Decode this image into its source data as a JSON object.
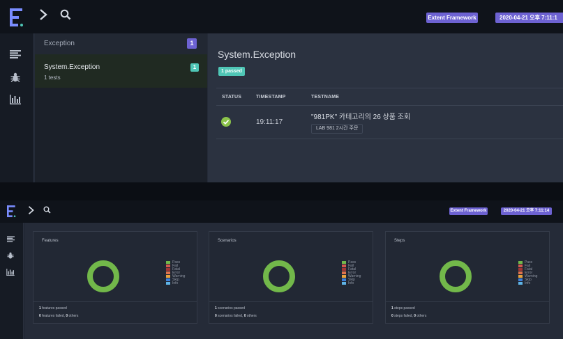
{
  "navbar": {
    "badge_framework": "Extent Framework",
    "badge_timestamp_top": "2020-04-21 오후 7:11:1",
    "badge_timestamp_bottom": "2020-04-21 오후 7:11:14"
  },
  "sidebar": {
    "items": [
      {
        "icon": "list-icon",
        "label": ""
      },
      {
        "icon": "bug-icon",
        "label": ""
      },
      {
        "icon": "bar-chart-icon",
        "label": ""
      }
    ]
  },
  "test_list": {
    "header": "Exception",
    "header_count": "1",
    "items": [
      {
        "name": "System.Exception",
        "sub": "1 tests",
        "count": "1"
      }
    ]
  },
  "detail": {
    "title": "System.Exception",
    "pass_badge": "1 passed",
    "columns": [
      "STATUS",
      "TIMESTAMP",
      "TESTNAME"
    ],
    "rows": [
      {
        "status": "pass",
        "timestamp": "19:11:17",
        "testname": "\"981PK\" 카테고리의 26 상품 조회",
        "tag": "LAB 981 2시간 주문"
      }
    ]
  },
  "dashboard": {
    "cards": [
      {
        "title": "Features",
        "line1_count": "1",
        "line1_text": " features passed",
        "line2_count_a": "0",
        "line2_text_a": " features failed, ",
        "line2_count_b": "0",
        "line2_text_b": " others"
      },
      {
        "title": "Scenarios",
        "line1_count": "1",
        "line1_text": " scenarios passed",
        "line2_count_a": "0",
        "line2_text_a": " scenarios failed, ",
        "line2_count_b": "0",
        "line2_text_b": " others"
      },
      {
        "title": "Steps",
        "line1_count": "1",
        "line1_text": " steps passed",
        "line2_count_a": "0",
        "line2_text_a": " steps failed, ",
        "line2_count_b": "0",
        "line2_text_b": " others"
      }
    ],
    "legend": [
      {
        "label": "Pass",
        "color": "#72b84a"
      },
      {
        "label": "Fail",
        "color": "#d3594f"
      },
      {
        "label": "Fatal",
        "color": "#a33636"
      },
      {
        "label": "Error",
        "color": "#e0734c"
      },
      {
        "label": "Warning",
        "color": "#e8a33f"
      },
      {
        "label": "Skip",
        "color": "#3d7fd9"
      },
      {
        "label": "Info",
        "color": "#5fb4e6"
      }
    ]
  },
  "colors": {
    "accent": "#6d62d2",
    "pass": "#8bc34a",
    "pass_badge": "#4fc6b6",
    "donut": "#72b84a"
  }
}
